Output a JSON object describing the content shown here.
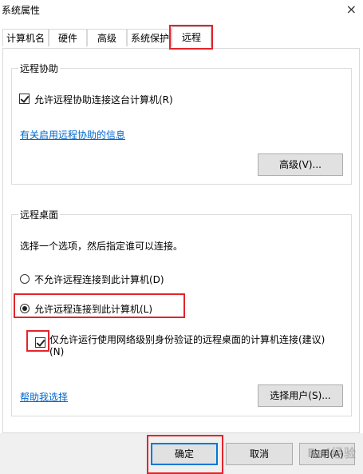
{
  "window": {
    "title": "系统属性",
    "close_glyph": "×"
  },
  "tabs": [
    {
      "label": "计算机名",
      "active": false
    },
    {
      "label": "硬件",
      "active": false
    },
    {
      "label": "高级",
      "active": false
    },
    {
      "label": "系统保护",
      "active": false
    },
    {
      "label": "远程",
      "active": true
    }
  ],
  "remote_assistance": {
    "group_title": "远程协助",
    "allow_checkbox_label": "允许远程协助连接这台计算机(R)",
    "allow_checked": true,
    "info_link": "有关启用远程协助的信息",
    "advanced_button": "高级(V)..."
  },
  "remote_desktop": {
    "group_title": "远程桌面",
    "instruction": "选择一个选项，然后指定谁可以连接。",
    "option_deny": "不允许远程连接到此计算机(D)",
    "option_allow": "允许远程连接到此计算机(L)",
    "selected": "allow",
    "nla_checkbox_label_line1": "仅允许运行使用网络级别身份验证的远程桌面的计算机连接(建议)",
    "nla_checkbox_label_line2": "(N)",
    "nla_checked": true,
    "help_link": "帮助我选择",
    "select_users_button": "选择用户(S)..."
  },
  "footer": {
    "ok_button": "确定",
    "cancel_button": "取消",
    "apply_button": "应用(A)"
  },
  "watermark": {
    "text": "Bai经验"
  },
  "colors": {
    "highlight_red": "#e3242b",
    "link_blue": "#0066cc",
    "default_button_border": "#0078d7"
  }
}
